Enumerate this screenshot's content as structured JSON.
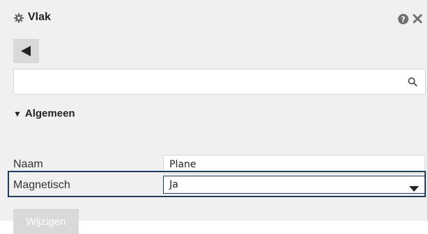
{
  "header": {
    "title": "Vlak",
    "icon": "gear-icon",
    "help_icon": "help-icon",
    "close_icon": "close-icon"
  },
  "toolbar": {
    "back_icon": "back-arrow-icon"
  },
  "search": {
    "value": "",
    "placeholder": "",
    "icon": "search-icon"
  },
  "section": {
    "indicator": "▼",
    "title": "Algemeen"
  },
  "fields": {
    "name": {
      "label": "Naam",
      "value": "Plane"
    },
    "magnetic": {
      "label": "Magnetisch",
      "value": "Ja"
    }
  },
  "actions": {
    "submit_label": "Wijzigen"
  },
  "colors": {
    "highlight": "#1f3a5f",
    "panel_bg": "#f0f0f0",
    "disabled_button": "#d9d9d9"
  }
}
